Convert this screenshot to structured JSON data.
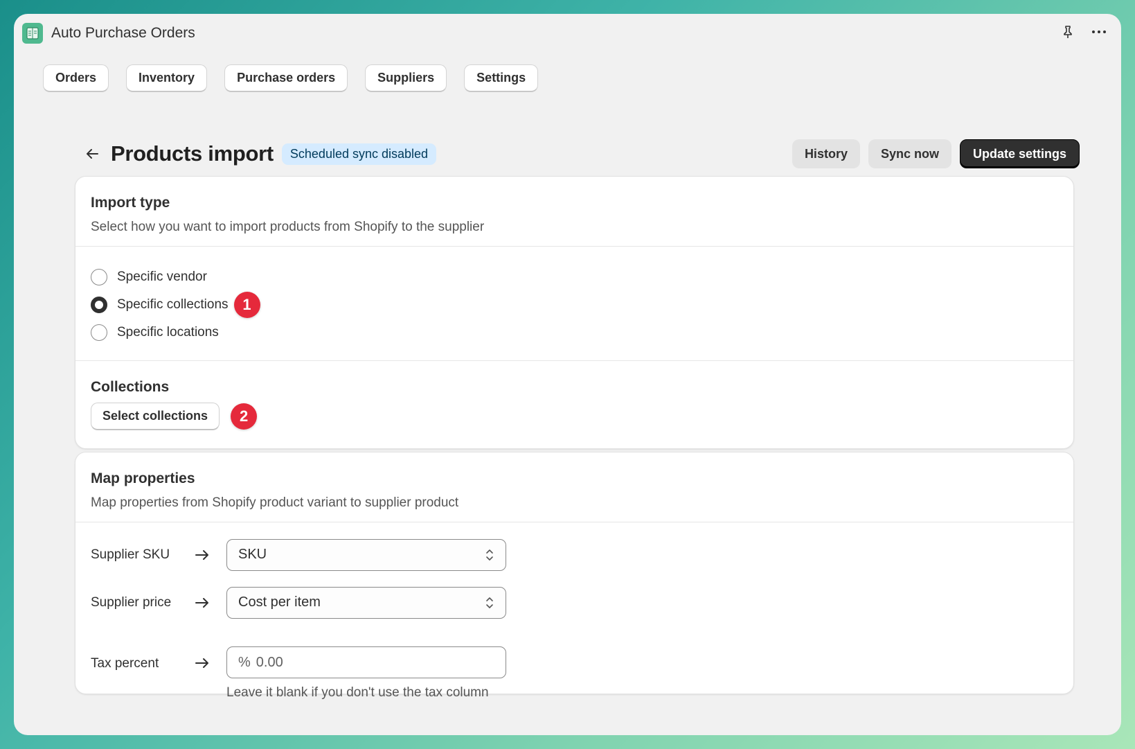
{
  "app": {
    "title": "Auto Purchase Orders",
    "icon": "spreadsheet-icon"
  },
  "nav": {
    "tabs": [
      {
        "label": "Orders"
      },
      {
        "label": "Inventory"
      },
      {
        "label": "Purchase orders"
      },
      {
        "label": "Suppliers"
      },
      {
        "label": "Settings"
      }
    ]
  },
  "header": {
    "title": "Products import",
    "badge": "Scheduled sync disabled",
    "history_label": "History",
    "sync_label": "Sync now",
    "update_label": "Update settings"
  },
  "import_type": {
    "title": "Import type",
    "subtitle": "Select how you want to import products from Shopify to the supplier",
    "options": [
      {
        "label": "Specific vendor",
        "selected": false
      },
      {
        "label": "Specific collections",
        "selected": true
      },
      {
        "label": "Specific locations",
        "selected": false
      }
    ],
    "step_badge_1": "1"
  },
  "collections": {
    "title": "Collections",
    "button_label": "Select collections",
    "step_badge_2": "2"
  },
  "map_properties": {
    "title": "Map properties",
    "subtitle": "Map properties from Shopify product variant to supplier product",
    "rows": [
      {
        "label": "Supplier SKU",
        "value": "SKU"
      },
      {
        "label": "Supplier price",
        "value": "Cost per item"
      }
    ],
    "tax": {
      "label": "Tax percent",
      "prefix": "%",
      "placeholder": "0.00",
      "help": "Leave it blank if you don't use the tax column"
    }
  },
  "colors": {
    "badge_bg": "#d5ebff",
    "step_badge": "#e5293b",
    "primary_button": "#303030"
  }
}
